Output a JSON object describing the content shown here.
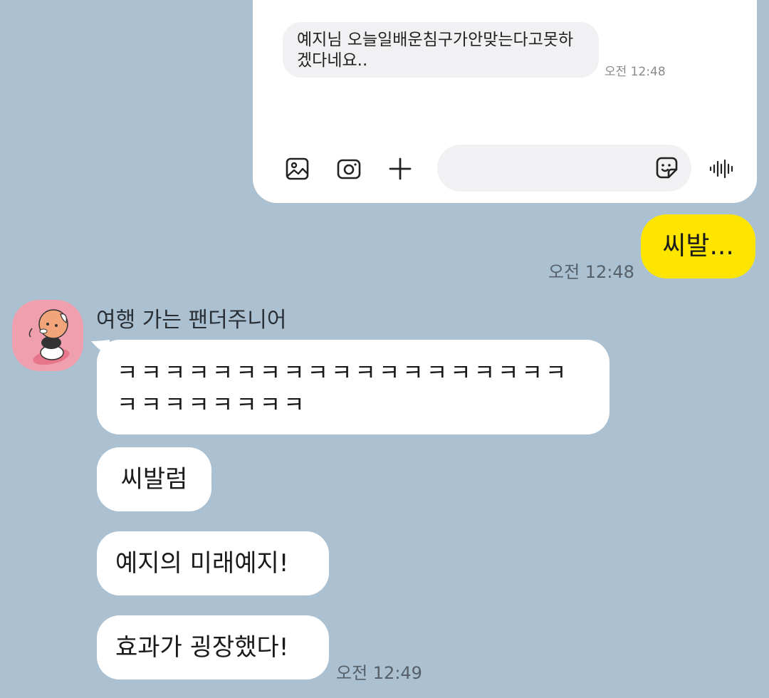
{
  "embedded_screenshot": {
    "message": "예지님 오늘일배운침구가안맞는다고못하겠다네요..",
    "time": "오전 12:48",
    "icons": [
      "gallery-icon",
      "camera-icon",
      "plus-icon",
      "emoji-icon",
      "voice-icon"
    ]
  },
  "my_message": {
    "text": "씨발...",
    "time": "오전 12:48"
  },
  "other_user": {
    "name": "여행 가는 팬더주니어",
    "messages": [
      "ㅋㅋㅋㅋㅋㅋㅋㅋㅋㅋㅋㅋㅋㅋㅋㅋㅋㅋㅋㅋㅋㅋㅋㅋㅋㅋㅋ",
      "씨발럼",
      "예지의 미래예지!",
      "효과가 굉장했다!"
    ],
    "time": "오전 12:49"
  },
  "colors": {
    "background": "#abc1d1",
    "my_bubble": "#fee500",
    "other_bubble": "#ffffff",
    "avatar_bg": "#ef9fae"
  }
}
